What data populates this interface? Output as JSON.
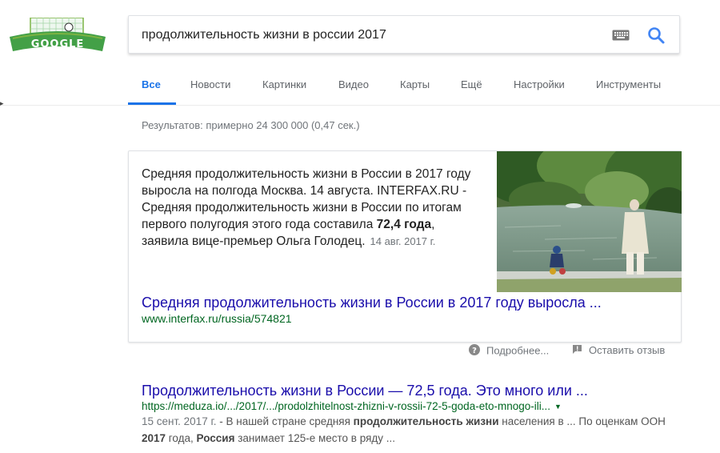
{
  "logo": {
    "text": "GOOGLE"
  },
  "search": {
    "query": "продолжительность жизни в россии 2017"
  },
  "tabs": [
    {
      "label": "Все"
    },
    {
      "label": "Новости"
    },
    {
      "label": "Картинки"
    },
    {
      "label": "Видео"
    },
    {
      "label": "Карты"
    },
    {
      "label": "Ещё"
    },
    {
      "label": "Настройки"
    },
    {
      "label": "Инструменты"
    }
  ],
  "stats": "Результатов: примерно 24 300 000 (0,47 сек.)",
  "featured": {
    "snippet_before": "Средняя продолжительность жизни в России в 2017 году выросла на полгода Москва. 14 августа. INTERFAX.RU - Средняя продолжительность жизни в России по итогам первого полугодия этого года составила ",
    "snippet_bold": "72,4 года",
    "snippet_after": ", заявила вице-премьер Ольга Голодец.",
    "date": "14 авг. 2017 г.",
    "title": "Средняя продолжительность жизни в России в 2017 году выросла ...",
    "url": "www.interfax.ru/russia/574821"
  },
  "feedback": {
    "more": "Подробнее...",
    "report": "Оставить отзыв"
  },
  "result2": {
    "title": "Продолжительность жизни в России — 72,5 года. Это много или ...",
    "url": "https://meduza.io/.../2017/.../prodolzhitelnost-zhizni-v-rossii-72-5-goda-eto-mnogo-ili...",
    "date": "15 сент. 2017 г.",
    "desc_1": " - В нашей стране средняя ",
    "desc_bold_1": "продолжительность жизни",
    "desc_2": " населения в ... По оценкам ООН ",
    "desc_bold_2": "2017",
    "desc_3": " года, ",
    "desc_bold_3": "Россия",
    "desc_4": " занимает 125-е место в ряду ..."
  },
  "colors": {
    "link": "#1a0dab",
    "url": "#006621",
    "accent": "#1a73e8"
  },
  "icons": [
    "soccer-doodle-logo",
    "keyboard-icon",
    "search-icon",
    "help-icon",
    "feedback-icon"
  ]
}
